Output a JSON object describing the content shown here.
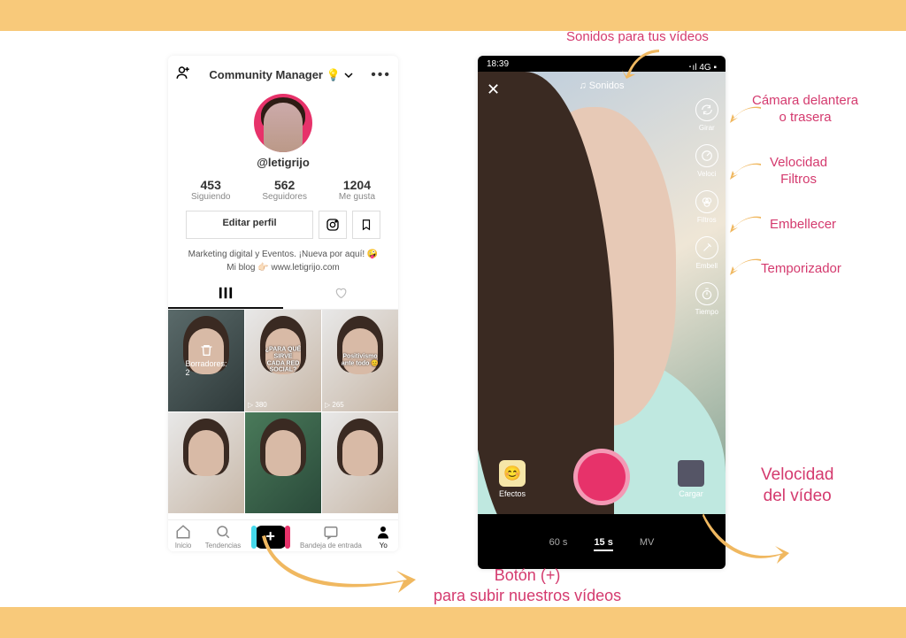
{
  "profile": {
    "title": "Community Manager 💡",
    "username": "@letigrijo",
    "stats": {
      "following": {
        "n": "453",
        "l": "Siguiendo"
      },
      "followers": {
        "n": "562",
        "l": "Seguidores"
      },
      "likes": {
        "n": "1204",
        "l": "Me gusta"
      }
    },
    "edit": "Editar perfil",
    "bio1": "Marketing digital y Eventos. ¡Nueva por aquí! 🤪",
    "bio2": "Mi blog 👉🏻 www.letigrijo.com",
    "drafts": "Borradores: 2",
    "caption2": "¿PARA QUÉ SIRVE CADA RED SOCIAL?",
    "caption3": "Positivismo ante todo 😊",
    "views2": "▷ 380",
    "views3": "▷ 265",
    "nav": {
      "home": "Inicio",
      "trends": "Tendencias",
      "inbox": "Bandeja de entrada",
      "me": "Yo"
    }
  },
  "camera": {
    "time": "18:39",
    "signal": "･ıl 4G ▪",
    "sounds": "♫ Sonidos",
    "tools": {
      "girar": "Girar",
      "vel": "Veloci",
      "filtros": "Filtros",
      "embell": "Embell",
      "tiempo": "Tiempo"
    },
    "efectos": "Efectos",
    "cargar": "Cargar",
    "modes": {
      "m60": "60 s",
      "m15": "15 s",
      "mv": "MV"
    }
  },
  "annotations": {
    "sonidos": "Sonidos para tus vídeos",
    "camara_l1": "Cámara delantera",
    "camara_l2": "o trasera",
    "vel_l1": "Velocidad",
    "vel_l2": "Filtros",
    "embell": "Embellecer",
    "temp": "Temporizador",
    "velvid_l1": "Velocidad",
    "velvid_l2": "del vídeo",
    "boton_l1": "Botón (+)",
    "boton_l2": "para subir nuestros vídeos"
  }
}
